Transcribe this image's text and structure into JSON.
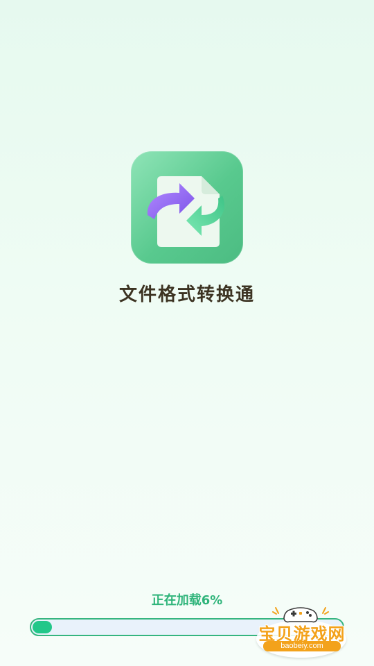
{
  "app": {
    "name": "文件格式转换通",
    "icon": "file-convert-icon"
  },
  "loading": {
    "text": "正在加载6%",
    "progress_percent": 6
  },
  "watermark": {
    "title": "宝贝游戏网",
    "subtitle": "baobeiy.com"
  },
  "colors": {
    "accent": "#2fb47a",
    "progress_fill": "#22c789",
    "progress_track": "#e9f2fb",
    "icon_green": "#58c98e",
    "arrow_purple": "#8b5cf6",
    "arrow_green": "#4ccf8e"
  }
}
